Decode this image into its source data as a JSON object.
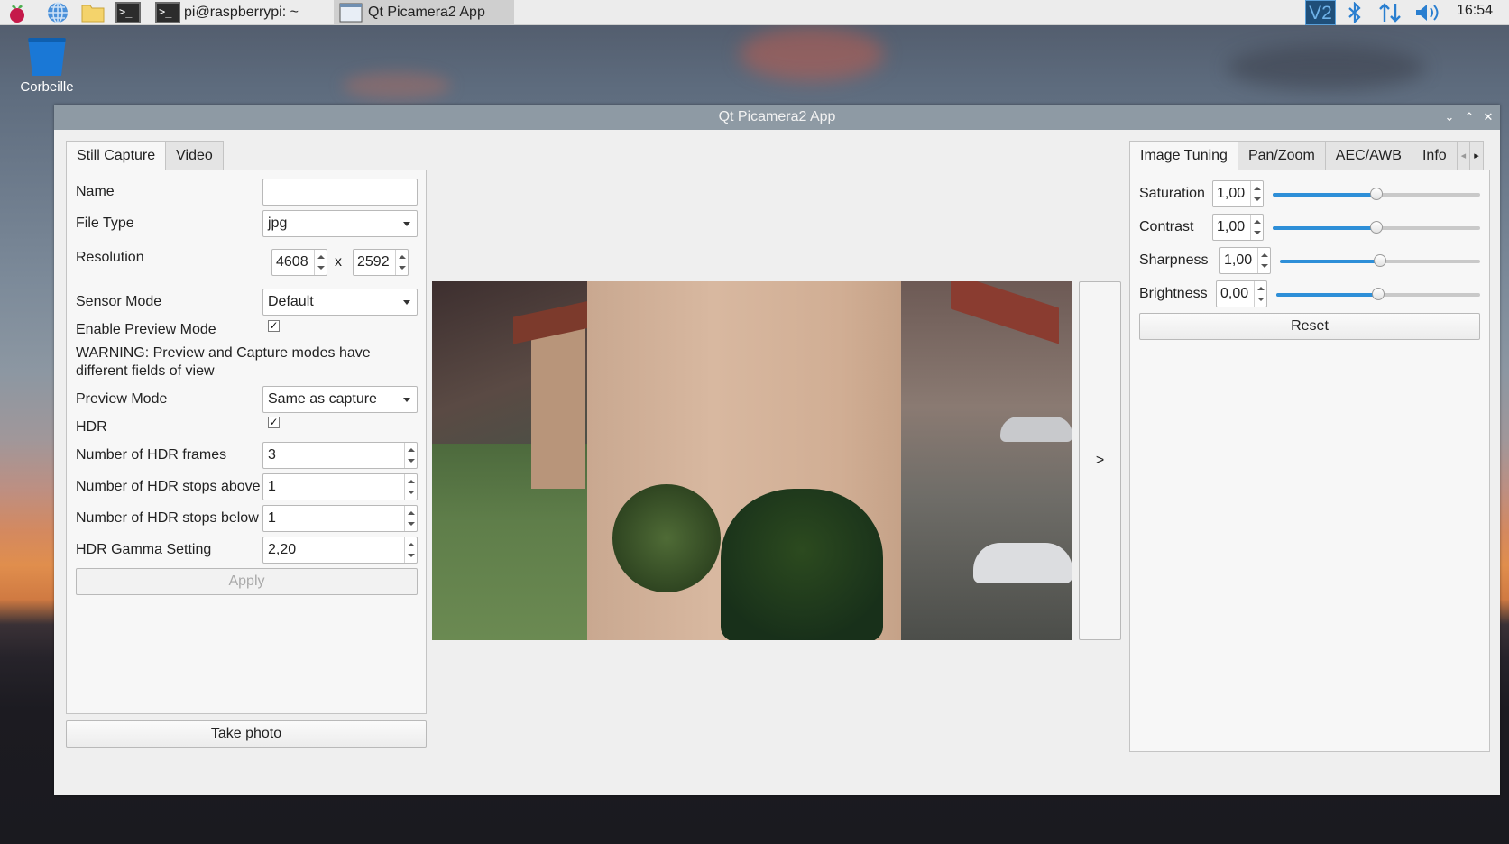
{
  "taskbar": {
    "tasks": [
      {
        "label": "pi@raspberrypi: ~"
      },
      {
        "label": "Qt Picamera2 App"
      }
    ],
    "tray": {
      "vnc": "V2"
    },
    "clock": "16:54"
  },
  "desktop": {
    "trash_label": "Corbeille"
  },
  "window": {
    "title": "Qt Picamera2 App",
    "left_tabs": [
      "Still Capture",
      "Video"
    ],
    "still": {
      "name_label": "Name",
      "name_value": "",
      "file_type_label": "File Type",
      "file_type_value": "jpg",
      "resolution_label": "Resolution",
      "res_width": "4608",
      "res_x": "x",
      "res_height": "2592",
      "sensor_mode_label": "Sensor Mode",
      "sensor_mode_value": "Default",
      "enable_preview_label": "Enable Preview Mode",
      "enable_preview_checked": "✓",
      "warning": "WARNING: Preview and Capture modes have different fields of view",
      "preview_mode_label": "Preview Mode",
      "preview_mode_value": "Same as capture",
      "hdr_label": "HDR",
      "hdr_checked": "✓",
      "hdr_frames_label": "Number of HDR frames",
      "hdr_frames_value": "3",
      "hdr_above_label": "Number of HDR stops above",
      "hdr_above_value": "1",
      "hdr_below_label": "Number of HDR stops below",
      "hdr_below_value": "1",
      "hdr_gamma_label": "HDR Gamma Setting",
      "hdr_gamma_value": "2,20",
      "apply_label": "Apply",
      "take_photo_label": "Take photo"
    },
    "expand_label": ">",
    "right_tabs": [
      "Image Tuning",
      "Pan/Zoom",
      "AEC/AWB",
      "Info"
    ],
    "tuning": {
      "saturation_label": "Saturation",
      "saturation_value": "1,00",
      "saturation_level": 0.5,
      "contrast_label": "Contrast",
      "contrast_value": "1,00",
      "contrast_level": 0.5,
      "sharpness_label": "Sharpness",
      "sharpness_value": "1,00",
      "sharpness_level": 0.5,
      "brightness_label": "Brightness",
      "brightness_value": "0,00",
      "brightness_level": 0.5,
      "reset_label": "Reset"
    }
  }
}
